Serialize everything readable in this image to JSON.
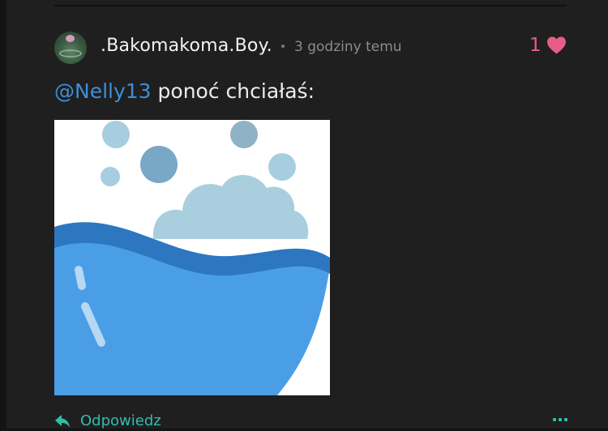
{
  "post": {
    "author": ".Bakomakoma.Boy.",
    "time": "3 godziny temu",
    "like_count": "1",
    "mention": "@Nelly13",
    "text": " ponoć chciałaś:",
    "reply_label": "Odpowiedz"
  },
  "icons": {
    "heart": "heart-icon",
    "reply": "reply-arrow-icon",
    "more": "more-options-icon"
  },
  "colors": {
    "background": "#1f1f1f",
    "mention": "#3e8ed9",
    "like": "#e85d88",
    "action": "#2fbfa8"
  }
}
